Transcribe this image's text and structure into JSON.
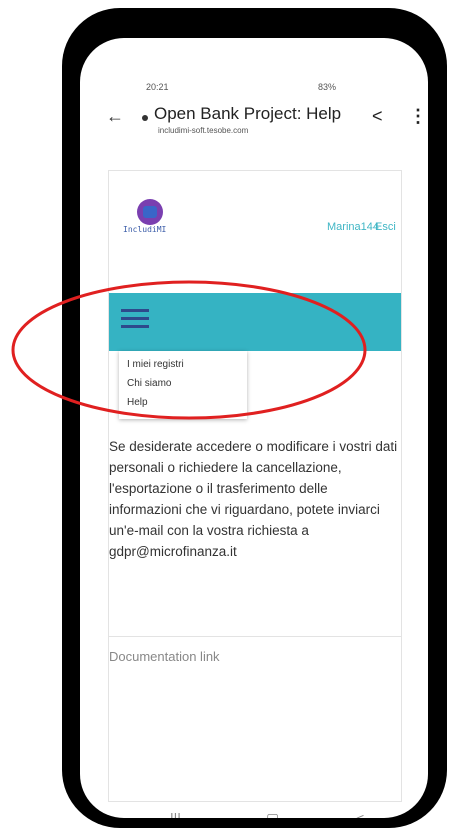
{
  "status_bar": {
    "time": "20:21",
    "indicators": "83%"
  },
  "browser": {
    "page_title": "Open Bank Project: Help",
    "domain": "includimi-soft.tesobe.com",
    "back_icon": "arrow-left-icon",
    "share_icon": "share-icon",
    "menu_icon": "kebab-icon"
  },
  "header": {
    "logo_text": "IncludiMI",
    "username": "Marina144",
    "logout": "Esci"
  },
  "menu": {
    "items": [
      "I miei registri",
      "Chi siamo",
      "Help"
    ]
  },
  "content": {
    "paragraph": "Se desiderate accedere o modificare i vostri dati personali o richiedere la cancellazione, l'esportazione o il trasferimento delle informazioni che vi riguardano, potete inviarci un'e-mail con la vostra richiesta a gdpr@microfinanza.it",
    "documentation_link": "Documentation link"
  },
  "nav_bar": {
    "recent": "|||",
    "home": "▢",
    "back": "<"
  },
  "colors": {
    "navbar": "#35b3c3",
    "accent_link": "#3fb6c5",
    "annotation": "#e02020"
  }
}
